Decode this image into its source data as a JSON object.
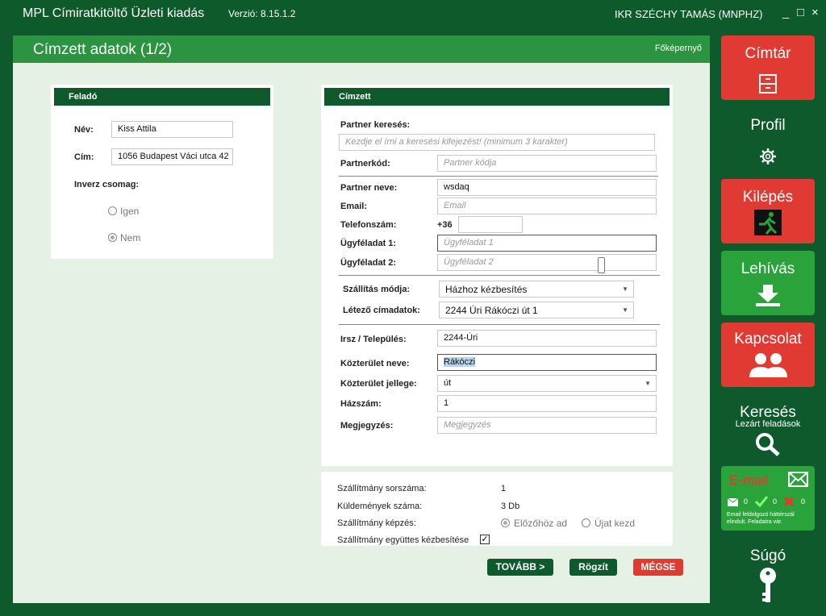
{
  "titlebar": {
    "app_name": "MPL Címiratkitöltő Üzleti kiadás",
    "version": "Verzió: 8.15.1.2",
    "user": "IKR SZÉCHY TAMÁS (MNPHZ)",
    "minimize": "_",
    "maximize": "□",
    "close": "×"
  },
  "header": {
    "title": "Címzett adatok (1/2)",
    "home_link": "Főképernyő"
  },
  "sender": {
    "title": "Feladó",
    "name_label": "Név:",
    "name_value": "Kiss Attila",
    "address_label": "Cím:",
    "address_value": "1056 Budapest Váci utca 42",
    "inverse_label": "Inverz csomag:",
    "yes_label": "Igen",
    "no_label": "Nem"
  },
  "recipient": {
    "title": "Címzett",
    "partner_search_label": "Partner keresés:",
    "partner_search_placeholder": "Kezdje el írni a keresési kifejezést! (minimum 3 karakter)",
    "partner_code_label": "Partnerkód:",
    "partner_code_placeholder": "Partner kódja",
    "partner_name_label": "Partner neve:",
    "partner_name_value": "wsdaq",
    "email_label": "Email:",
    "email_placeholder": "Email",
    "phone_label": "Telefonszám:",
    "phone_prefix": "+36",
    "phone_value": "",
    "admin1_label": "Ügyféladat 1:",
    "admin1_placeholder": "Ügyféladat 1",
    "admin2_label": "Ügyféladat 2:",
    "admin2_placeholder": "Ügyféladat 2",
    "shipping_label": "Szállítás módja:",
    "shipping_value": "Házhoz kézbesítés",
    "existing_label": "Létező címadatok:",
    "existing_value": "2244 Úri Rákóczi út 1",
    "zip_label": "Irsz / Település:",
    "zip_value": "2244-Úri",
    "street_label": "Közterület neve:",
    "street_value": "Rákóczi",
    "street_type_label": "Közterület jellege:",
    "street_type_value": "út",
    "house_label": "Házszám:",
    "house_value": "1",
    "note_label": "Megjegyzés:",
    "note_placeholder": "Megjegyzés"
  },
  "shipment": {
    "serial_label": "Szállítmány sorszáma:",
    "serial_value": "1",
    "count_label": "Küldemények száma:",
    "count_value": "3 Db",
    "form_label": "Szállítmány képzés:",
    "prev_label": "Előzőhöz ad",
    "new_label": "Újat kezd",
    "joint_label": "Szállítmány együttes kézbesítése",
    "joint_checked": "✓"
  },
  "buttons": {
    "next": "TOVÁBB >",
    "save": "Rögzít",
    "cancel": "MÉGSE"
  },
  "sidebar": {
    "directory": "Címtár",
    "profile": "Profil",
    "exit": "Kilépés",
    "pickup": "Lehívás",
    "contact": "Kapcsolat",
    "search": "Keresés",
    "search_sub": "Lezárt feladások",
    "email": "E-mail",
    "email_count1": "0",
    "email_count2": "0",
    "email_count3": "0",
    "email_status": "Email feldolgozó háttérszál elindult. Feladatra vár.",
    "help": "Súgó"
  },
  "colors": {
    "dark_green": "#0f5a2c",
    "green": "#2b9440",
    "red": "#e03a33",
    "light_bg": "#e4f1e4"
  }
}
